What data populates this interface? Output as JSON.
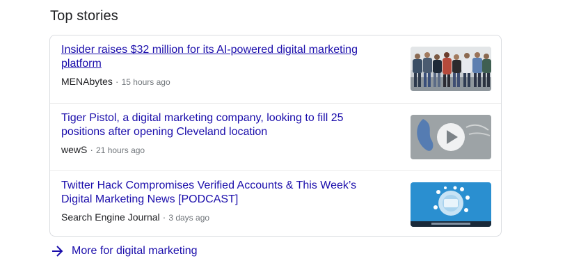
{
  "section": {
    "title": "Top stories"
  },
  "stories": [
    {
      "headline": "Insider raises $32 million for its AI-powered digital marketing platform",
      "source": "MENAbytes",
      "separator": "·",
      "time": "15 hours ago",
      "thumbnail": "group-photo-thumbnail"
    },
    {
      "headline": "Tiger Pistol, a digital marketing company, looking to fill 25 positions after opening Cleveland location",
      "source": "wewS",
      "separator": "·",
      "time": "21 hours ago",
      "thumbnail": "video-thumbnail"
    },
    {
      "headline": "Twitter Hack Compromises Verified Accounts & This Week’s Digital Marketing News [PODCAST]",
      "source": "Search Engine Journal",
      "separator": "·",
      "time": "3 days ago",
      "thumbnail": "podcast-thumbnail"
    }
  ],
  "more": {
    "label": "More for digital marketing",
    "icon": "arrow-right-icon"
  },
  "colors": {
    "link": "#1a0dab",
    "meta": "#70757a",
    "border": "#dadce0"
  }
}
